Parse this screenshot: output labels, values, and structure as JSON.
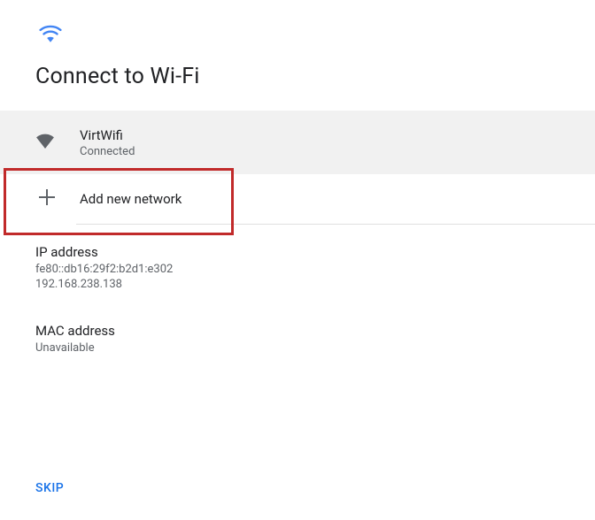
{
  "header": {
    "title": "Connect to Wi-Fi"
  },
  "network": {
    "name": "VirtWifi",
    "status": "Connected"
  },
  "add_network_label": "Add new network",
  "ip": {
    "label": "IP address",
    "values": "fe80::db16:29f2:b2d1:e302\n192.168.238.138"
  },
  "mac": {
    "label": "MAC address",
    "value": "Unavailable"
  },
  "footer": {
    "skip": "SKIP"
  },
  "colors": {
    "accent": "#1a73e8",
    "highlight": "#c12a2a"
  }
}
